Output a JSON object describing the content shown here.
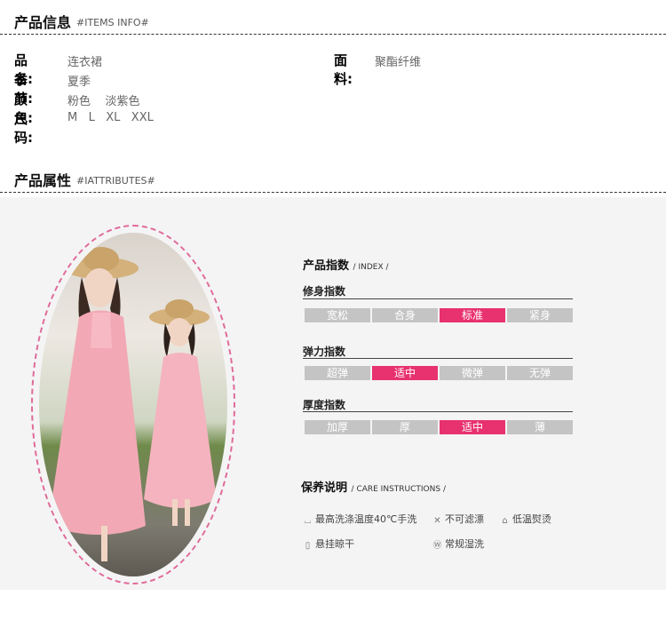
{
  "items_info": {
    "title": "产品信息",
    "subtitle": "#ITEMS INFO#",
    "rows": [
      {
        "label": "品名:",
        "value": "连衣裙"
      },
      {
        "label": "季 节:",
        "value": "夏季"
      },
      {
        "label": "颜色:",
        "value": "粉色    淡紫色"
      },
      {
        "label": "尺码:",
        "value": "M   L   XL   XXL"
      }
    ],
    "fabric": {
      "label": "面料:",
      "value": "聚酯纤维"
    }
  },
  "attributes": {
    "title": "产品属性",
    "subtitle": "#IATTRIBUTES#"
  },
  "index": {
    "title": "产品指数",
    "subtitle": "/ INDEX /",
    "categories": [
      {
        "name": "修身指数",
        "options": [
          "宽松",
          "合身",
          "标准",
          "紧身"
        ],
        "selected": 2
      },
      {
        "name": "弹力指数",
        "options": [
          "超弹",
          "适中",
          "微弹",
          "无弹"
        ],
        "selected": 1
      },
      {
        "name": "厚度指数",
        "options": [
          "加厚",
          "厚",
          "适中",
          "薄"
        ],
        "selected": 2
      }
    ]
  },
  "care": {
    "title": "保养说明",
    "subtitle": "/ CARE INSTRUCTIONS /",
    "items": [
      {
        "icon": "wash-tub-icon",
        "text": "最高洗涤温度40℃手洗"
      },
      {
        "icon": "no-bleach-icon",
        "text": "不可滤漂"
      },
      {
        "icon": "iron-icon",
        "text": "低温熨烫"
      },
      {
        "icon": "hang-dry-icon",
        "text": "悬挂晾干"
      },
      {
        "icon": "dry-clean-icon",
        "text": "常规湿洗"
      }
    ]
  },
  "colors": {
    "accent": "#e8316f",
    "inactive": "#c4c4c4",
    "oval_border": "#e06a9a"
  }
}
